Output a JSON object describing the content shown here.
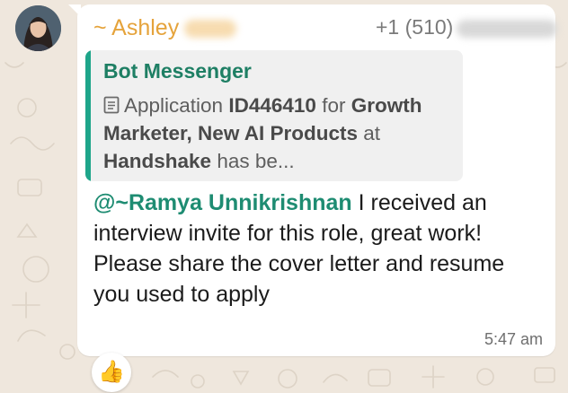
{
  "message": {
    "sender_name": "~ Ashley",
    "sender_phone": "+1 (510)",
    "quoted": {
      "author": "Bot Messenger",
      "text_lead": "Application",
      "application_id": "ID446410",
      "text_for": "for",
      "role": "Growth Marketer, New AI Products",
      "text_at": "at",
      "company": "Handshake",
      "text_tail": "has be..."
    },
    "mention": "@~Ramya Unnikrishnan",
    "body_line1": " I received an interview invite for this role, great work!",
    "body_line2": "Please share the cover letter and resume you used to apply",
    "time": "5:47 am",
    "reaction": "👍"
  },
  "colors": {
    "sender": "#e5a33b",
    "quote_bar": "#1ea58a",
    "mention": "#1e8c72",
    "wallpaper": "#efe7dd"
  },
  "icons": {
    "quoted_message": "document-icon",
    "reaction": "thumbs-up-emoji"
  }
}
